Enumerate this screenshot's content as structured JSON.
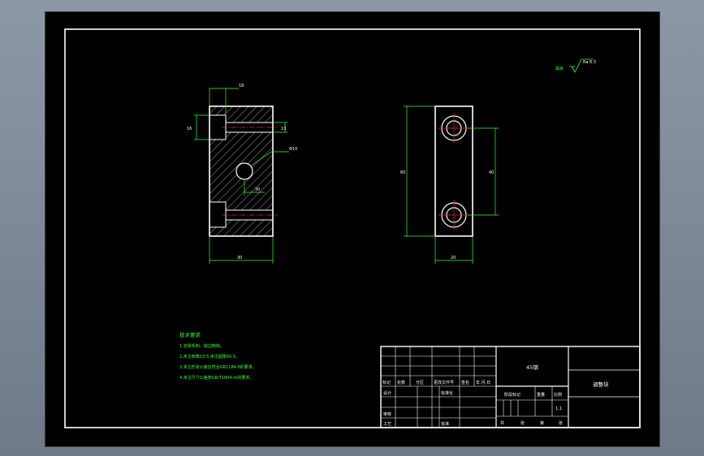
{
  "colors": {
    "background": "#000000",
    "frame": "#ffffff",
    "dimension": "#39ff39",
    "centerline": "#ff2020",
    "window_bg": "#7f8b99"
  },
  "roughness": {
    "label": "其余",
    "value": "Ra 6.3"
  },
  "front_view_dims": {
    "top_small": "18",
    "left_small": "16",
    "right_small": "13",
    "hole_callout": "Φ10",
    "inner": "30",
    "bottom": "30"
  },
  "side_view_dims": {
    "height": "60",
    "centers": "40",
    "width": "20"
  },
  "tech_requirements": {
    "title": "技术要求",
    "items": [
      "1.去除毛刺、锐边倒钝。",
      "2.未注倒角C0.5,未注圆角R0.5。",
      "3.未注形状公差应符合GB1184-8的要求。",
      "4.未注尺寸公差按GB/T1804-m的要求。"
    ]
  },
  "title_block": {
    "material": "45钢",
    "part_name": "调整块",
    "revision_headers": [
      "标记",
      "处数",
      "分区",
      "更改文件号",
      "签名",
      "年.月.日"
    ],
    "designer_label": "设计",
    "standardization_label": "标准化",
    "checker_label": "审核",
    "process_label": "工艺",
    "approve_label": "批准",
    "stage_label": "阶段标记",
    "weight_label": "重量",
    "scale_label": "比例",
    "scale_value": "1:1",
    "sheet_labels": [
      "共",
      "张",
      "第",
      "张"
    ]
  }
}
